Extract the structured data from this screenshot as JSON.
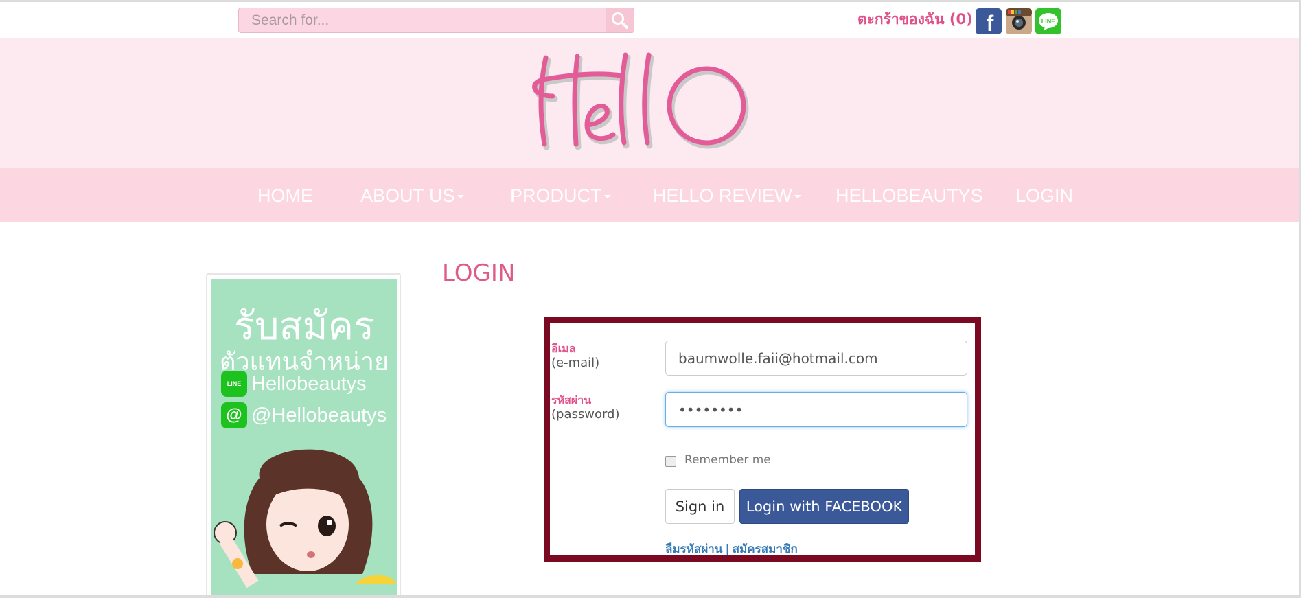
{
  "search": {
    "placeholder": "Search for..."
  },
  "cart": {
    "label": "ตะกร้าของฉัน (0)",
    "separator": "|"
  },
  "social": {
    "facebook": "f",
    "line": "LINE"
  },
  "nav": {
    "home": "HOME",
    "about": "ABOUT US",
    "product": "PRODUCT",
    "review": "HELLO REVIEW",
    "beautys": "HELLOBEAUTYS",
    "login": "LOGIN"
  },
  "banner": {
    "line1": "รับสมัคร",
    "line2": "ตัวแทนจำหน่าย",
    "line_id": "Hellobeautys",
    "at_id": "@Hellobeautys",
    "line_chip": "LINE",
    "at_chip": "@"
  },
  "page": {
    "title": "LOGIN"
  },
  "form": {
    "email_label_th": "อีเมล",
    "email_label_en": "(e-mail)",
    "email_value": "baumwolle.faii@hotmail.com",
    "password_label_th": "รหัสผ่าน",
    "password_label_en": "(password)",
    "password_value": "••••••••",
    "remember_label": "Remember me",
    "signin_label": "Sign in",
    "facebook_label": "Login with FACEBOOK",
    "forgot_label": "ลืมรหัสผ่าน",
    "link_separator": "|",
    "register_label": "สมัครสมาชิก"
  },
  "colors": {
    "accent_pink": "#e0518a",
    "nav_bg": "#fcd6e1",
    "header_bg": "#fdeaf0",
    "panel_border": "#7a0a22",
    "facebook_blue": "#3b5998"
  }
}
